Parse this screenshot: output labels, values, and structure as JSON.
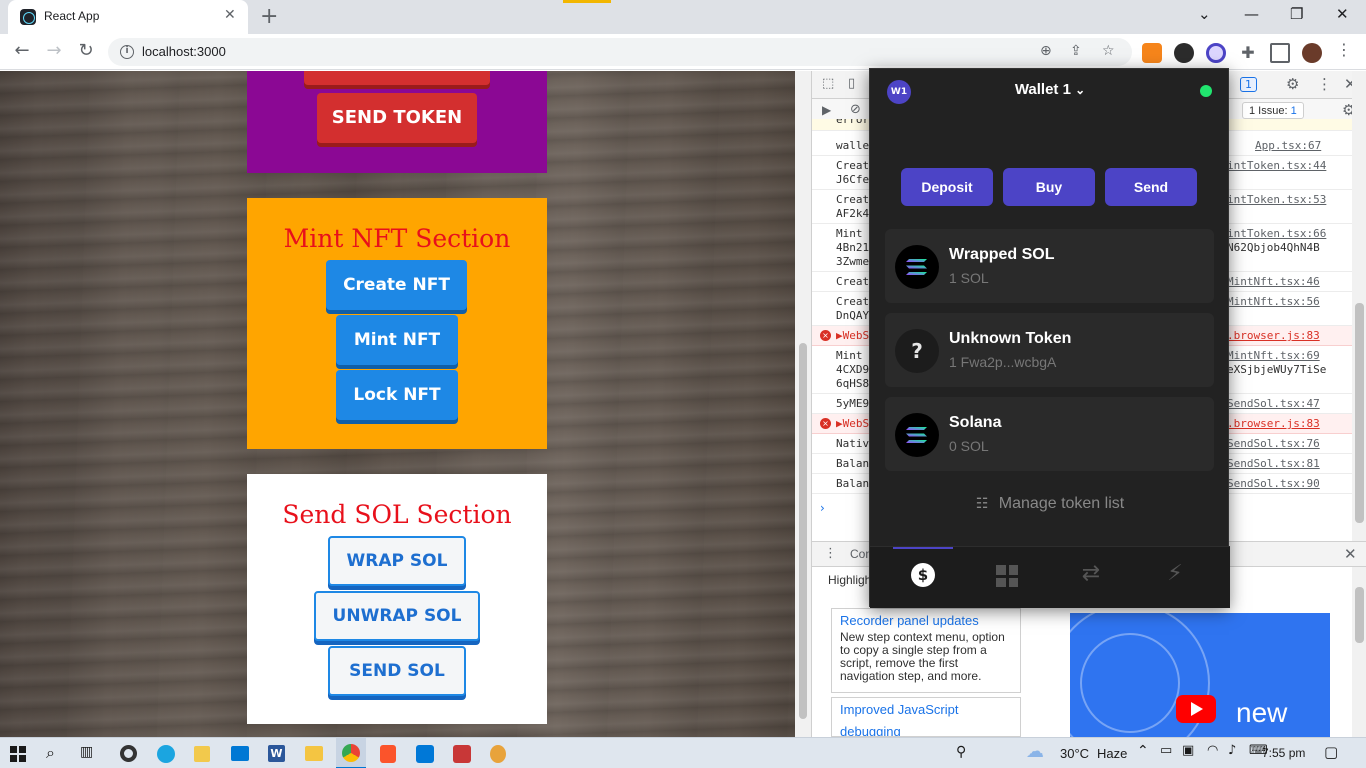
{
  "browser": {
    "tab_title": "React App",
    "tab_close": "✕",
    "new_tab": "+",
    "url": "localhost:3000",
    "window_controls": [
      "⌄",
      "—",
      "❐",
      "✕"
    ]
  },
  "page": {
    "top_section": {
      "send_token_label": "SEND TOKEN"
    },
    "mint_section": {
      "title": "Mint NFT Section",
      "buttons": [
        "Create NFT",
        "Mint NFT",
        "Lock NFT"
      ]
    },
    "sol_section": {
      "title": "Send SOL Section",
      "buttons": [
        "WRAP SOL",
        "UNWRAP SOL",
        "SEND SOL"
      ]
    },
    "colors": {
      "top_card": "#8b0894",
      "mint_card": "#ffa500",
      "sol_card": "#ffffff",
      "section_title": "#e8101b"
    }
  },
  "devtools": {
    "issues_label": "1 Issue:",
    "issues_count": "1",
    "badge_count": "1",
    "log_rows": [
      {
        "msg": "wallet",
        "src": "App.tsx:67",
        "level": "info"
      },
      {
        "msg": "Creat",
        "msg2": "J6Cfe",
        "src": "intToken.tsx:44",
        "level": "info"
      },
      {
        "msg": "Creat",
        "msg2": "AF2k4",
        "src": "intToken.tsx:53",
        "level": "info"
      },
      {
        "msg": "Mint",
        "msg2": "4Bn21",
        "msg3": "3Zwme",
        "src": "intToken.tsx:66",
        "src2": "N62Qbjob4QhN4B",
        "level": "info"
      },
      {
        "msg": "Creat",
        "src": "MintNft.tsx:46",
        "level": "info"
      },
      {
        "msg": "Creat",
        "msg2": "DnQAY",
        "src": "MintNft.tsx:56",
        "level": "info"
      },
      {
        "msg": "▶WebS",
        "src": ".browser.js:83",
        "level": "error"
      },
      {
        "msg": "Mint",
        "msg2": "4CXD9",
        "msg3": "6qHS8",
        "src": "MintNft.tsx:69",
        "src2": "eXSjbjeWUy7TiSe",
        "level": "info"
      },
      {
        "msg": "5yME9",
        "src": "SendSol.tsx:47",
        "level": "info"
      },
      {
        "msg": "▶WebS",
        "src": ".browser.js:83",
        "level": "error"
      },
      {
        "msg": "Nativ",
        "src": "SendSol.tsx:76",
        "level": "info"
      },
      {
        "msg": "Balan",
        "src": "SendSol.tsx:81",
        "level": "info"
      },
      {
        "msg": "Balan",
        "src": "SendSol.tsx:90",
        "level": "info"
      }
    ],
    "prompt": "›",
    "truncated_first_row": "error",
    "bottom_panel": {
      "tab_label": "Con",
      "highlights_label": "Highligh",
      "update_title": "Recorder panel updates",
      "update_desc": "New step context menu, option to copy a single step from a script, remove the first navigation step, and more.",
      "update2_title": "Improved JavaScript",
      "update2_title_line2": "debugging",
      "video_text": "new"
    }
  },
  "wallet": {
    "avatar": "W1",
    "title": "Wallet 1",
    "caret": "⌄",
    "status_color": "#21e56f",
    "actions": [
      "Deposit",
      "Buy",
      "Send"
    ],
    "accent": "#4c44c6",
    "tokens": [
      {
        "name": "Wrapped SOL",
        "amount": "1 SOL",
        "icon": "solana-icon"
      },
      {
        "name": "Unknown Token",
        "amount": "1 Fwa2p...wcbgA",
        "icon": "question-icon"
      },
      {
        "name": "Solana",
        "amount": "0 SOL",
        "icon": "solana-icon"
      }
    ],
    "manage_label": "Manage token list",
    "tabs": [
      "dollar-icon",
      "grid-icon",
      "swap-icon",
      "bolt-icon"
    ]
  },
  "taskbar": {
    "weather": "30°C",
    "weather_desc": "Haze",
    "time": "7:55 pm"
  }
}
